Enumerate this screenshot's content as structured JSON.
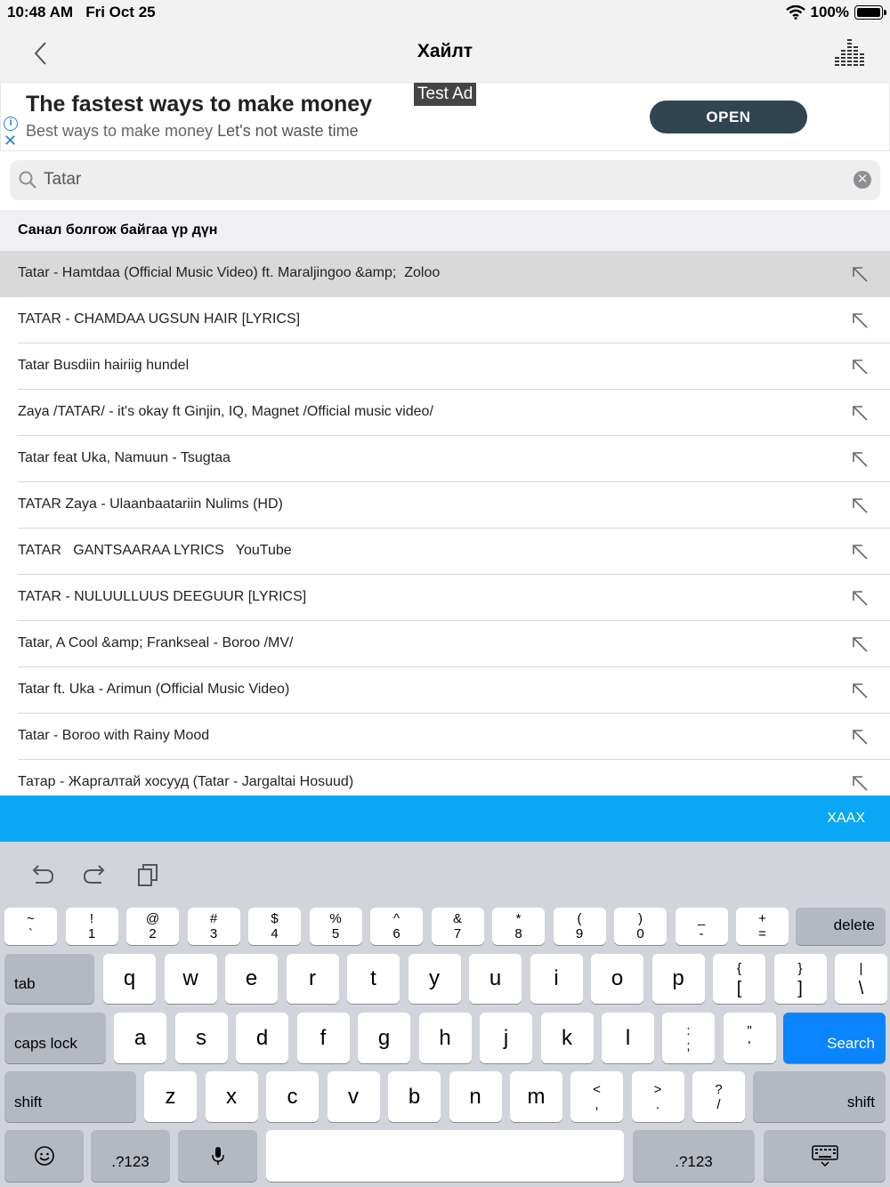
{
  "status": {
    "time": "10:48 AM",
    "date": "Fri Oct 25",
    "battery": "100%"
  },
  "nav": {
    "title": "Хайлт",
    "back_icon": "chevron-left-icon",
    "equalizer_icon": "equalizer-icon"
  },
  "ad": {
    "headline": "The fastest ways to make money",
    "sub_a": "Best ways to make money",
    "sub_b": "Let's not waste time",
    "badge": "Test Ad",
    "cta": "OPEN",
    "info": "i",
    "close": "✕"
  },
  "search": {
    "value": "Tatar",
    "placeholder": "",
    "clear": "✕"
  },
  "suggestions": {
    "header": "Санал болгож байгаа үр дүн",
    "items": [
      "Tatar - Hamtdaa (Official Music Video) ft. Maraljingoo &amp;  Zoloo",
      "TATAR - CHAMDAA UGSUN HAIR [LYRICS]",
      "Tatar Busdiin hairiig hundel",
      "Zaya /TATAR/ - it's okay ft Ginjin, IQ, Magnet /Official music video/",
      "Tatar feat Uka, Namuun - Tsugtaa",
      "TATAR Zaya - Ulaanbaatariin Nulims (HD)",
      "TATAR   GANTSAARAA LYRICS   YouTube",
      "TATAR - NULUULLUUS DEEGUUR [LYRICS]",
      "Tatar, A Cool &amp; Frankseal - Boroo /MV/",
      "Tatar ft. Uka - Arimun (Official Music Video)",
      "Tatar - Boroo with Rainy Mood",
      "Татар - Жаргалтай хосууд (Tatar - Jargaltai Hosuud)"
    ]
  },
  "actionbar": {
    "close": "ХААХ"
  },
  "keyboard": {
    "row1": [
      [
        "~",
        "`"
      ],
      [
        "!",
        "1"
      ],
      [
        "@",
        "2"
      ],
      [
        "#",
        "3"
      ],
      [
        "$",
        "4"
      ],
      [
        "%",
        "5"
      ],
      [
        "^",
        "6"
      ],
      [
        "&",
        "7"
      ],
      [
        "*",
        "8"
      ],
      [
        "(",
        "9"
      ],
      [
        ")",
        "0"
      ],
      [
        "_",
        "-"
      ],
      [
        "+",
        "="
      ]
    ],
    "delete": "delete",
    "tab": "tab",
    "row2": [
      "q",
      "w",
      "e",
      "r",
      "t",
      "y",
      "u",
      "i",
      "o",
      "p"
    ],
    "row2_sym": [
      [
        "{",
        "["
      ],
      [
        "}",
        "]"
      ],
      [
        "|",
        "\\"
      ]
    ],
    "caps": "caps lock",
    "row3": [
      "a",
      "s",
      "d",
      "f",
      "g",
      "h",
      "j",
      "k",
      "l"
    ],
    "row3_sym": [
      [
        ":",
        ";"
      ],
      [
        "\"",
        "'"
      ]
    ],
    "search": "Search",
    "shift": "shift",
    "row4": [
      "z",
      "x",
      "c",
      "v",
      "b",
      "n",
      "m"
    ],
    "row4_sym": [
      [
        "<",
        ","
      ],
      [
        ">",
        "."
      ],
      [
        "?",
        "/"
      ]
    ],
    "numbers": ".?123"
  }
}
